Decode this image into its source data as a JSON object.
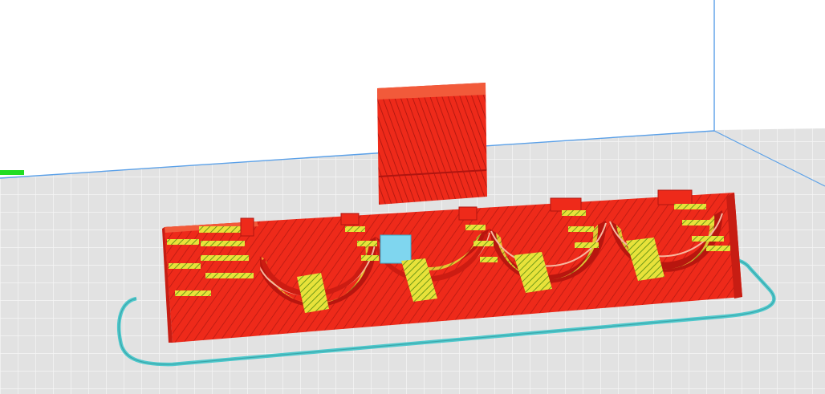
{
  "viewport": {
    "background": "#ffffff",
    "build_plate_color": "#e0e0e0",
    "grid_line_color": "#f4f4f4",
    "back_wall_line_color": "#5aa0e8",
    "skirt_color": "#5ad6d6",
    "model_color": "#ee2a1a",
    "model_dark_color": "#b01510",
    "infill_color": "#f0e838",
    "support_color": "#7fd6ef",
    "axis_indicator_color": "#22dd22"
  },
  "model": {
    "name": "",
    "view": "layer-view"
  }
}
